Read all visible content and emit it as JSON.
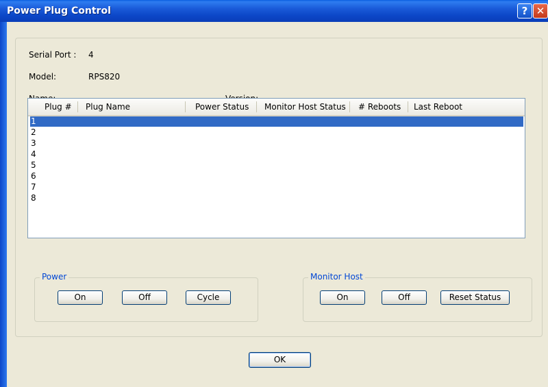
{
  "window": {
    "title": "Power Plug Control",
    "help_glyph": "?",
    "close_glyph": "✕"
  },
  "info": {
    "serial_port_label": "Serial Port :",
    "serial_port_value": "4",
    "model_label": "Model:",
    "model_value": "RPS820",
    "name_label": "Name:",
    "name_value": "",
    "version_label": "Version:",
    "version_value": ""
  },
  "table": {
    "columns": [
      "Plug #",
      "Plug Name",
      "Power Status",
      "Monitor Host Status",
      "# Reboots",
      "Last Reboot"
    ],
    "rows": [
      "1",
      "2",
      "3",
      "4",
      "5",
      "6",
      "7",
      "8"
    ],
    "selected_row": "1"
  },
  "power_group": {
    "legend": "Power",
    "on": "On",
    "off": "Off",
    "cycle": "Cycle"
  },
  "monitor_group": {
    "legend": "Monitor Host",
    "on": "On",
    "off": "Off",
    "reset": "Reset Status"
  },
  "ok_label": "OK",
  "colors": {
    "title_bar": "#0c47c8",
    "selection": "#316ac5",
    "group_legend": "#0046d5",
    "dialog_bg": "#ece9d8"
  }
}
